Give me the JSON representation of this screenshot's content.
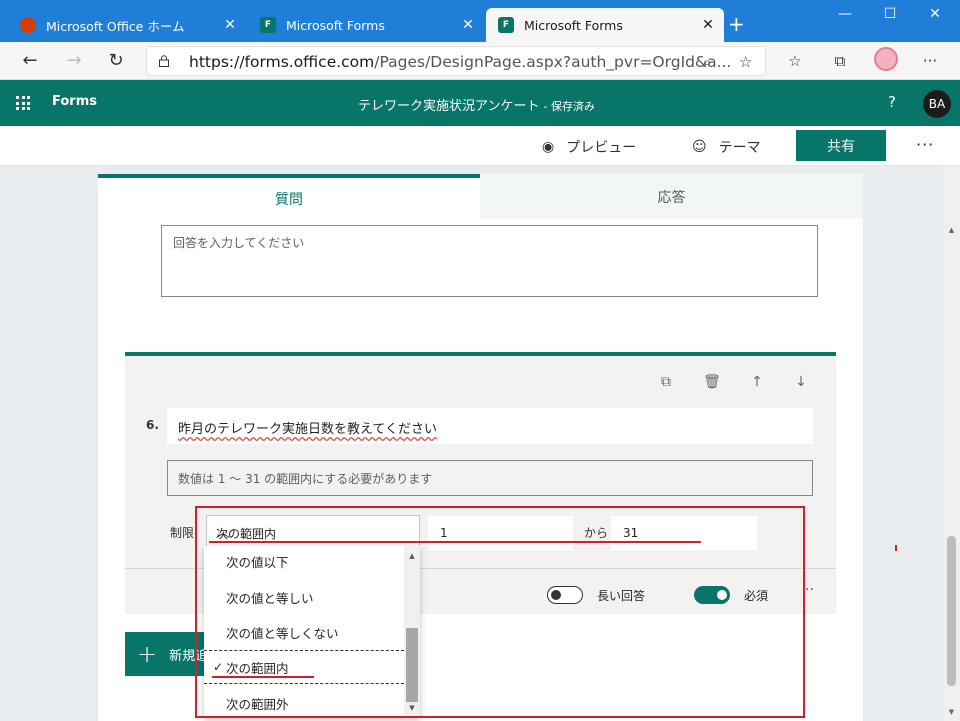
{
  "browser": {
    "tabs": [
      {
        "title": "Microsoft Office ホーム",
        "icon": "office-icon"
      },
      {
        "title": "Microsoft Forms",
        "icon": "forms-icon"
      },
      {
        "title": "Microsoft Forms",
        "icon": "forms-icon",
        "active": true
      }
    ],
    "url_main": "https://forms.office.com",
    "url_rest": "/Pages/DesignPage.aspx?auth_pvr=OrgId&a..."
  },
  "app": {
    "name": "Forms",
    "form_title": "テレワーク実施状況アンケート",
    "saved_label": "- 保存済み",
    "help": "?",
    "avatar_initials": "BA"
  },
  "commands": {
    "preview": "プレビュー",
    "theme": "テーマ",
    "share": "共有"
  },
  "form_tabs": {
    "questions": "質問",
    "responses": "応答"
  },
  "answer_placeholder": "回答を入力してください",
  "question": {
    "number": "6.",
    "title": "昨月のテレワーク実施日数を教えてください",
    "subtitle_placeholder": "数値は 1 ～ 31 の範囲内にする必要があります",
    "limit_label": "制限",
    "selected_restriction": "次の範囲内",
    "from_value": "1",
    "to_label": "から",
    "to_value": "31",
    "long_answer_label": "長い回答",
    "required_label": "必須",
    "long_answer_on": false,
    "required_on": true
  },
  "new_button_label": "新規追加",
  "dropdown": {
    "options": [
      "次の値以下",
      "次の値と等しい",
      "次の値と等しくない",
      "次の範囲内",
      "次の範囲外"
    ],
    "selected_index": 3,
    "check": "✓"
  },
  "colors": {
    "brand": "#077568",
    "browser_blue": "#1f7fd8",
    "annotation_red": "#d0202b"
  }
}
